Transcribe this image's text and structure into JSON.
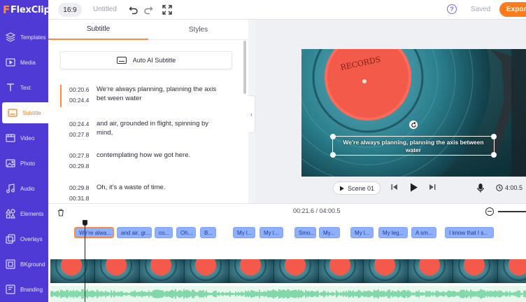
{
  "app": {
    "logo": "FlexClip",
    "title": "Untitled"
  },
  "toolbar": {
    "ratio": "16:9",
    "saved_label": "Saved",
    "export_label": "Export",
    "help": "?"
  },
  "sidebar": {
    "items": [
      {
        "label": "Templates",
        "icon": "layers-icon"
      },
      {
        "label": "Media",
        "icon": "media-icon"
      },
      {
        "label": "Text",
        "icon": "text-icon"
      },
      {
        "label": "Subtitle",
        "icon": "subtitle-icon",
        "active": true
      },
      {
        "label": "Video",
        "icon": "video-icon"
      },
      {
        "label": "Photo",
        "icon": "photo-icon"
      },
      {
        "label": "Audio",
        "icon": "audio-icon"
      },
      {
        "label": "Elements",
        "icon": "elements-icon"
      },
      {
        "label": "Overlays",
        "icon": "overlays-icon"
      },
      {
        "label": "BKground",
        "icon": "background-icon"
      },
      {
        "label": "Branding",
        "icon": "branding-icon"
      }
    ]
  },
  "panel": {
    "tabs": [
      "Subtitle",
      "Styles"
    ],
    "auto_ai_label": "Auto AI Subtitle",
    "subtitles": [
      {
        "start": "00:20.6",
        "end": "00:24.4",
        "text": "We're always planning, planning the axis bet ween water"
      },
      {
        "start": "00:24.4",
        "end": "00:27.8",
        "text": "and air, grounded in flight, spinning by mind,"
      },
      {
        "start": "00:27.8",
        "end": "00:29.8",
        "text": "contemplating how we got here."
      },
      {
        "start": "00:29.8",
        "end": "00:31.8",
        "text": "Oh, it's a waste of time."
      }
    ]
  },
  "preview": {
    "caption": "We're always planning, planning the axis between water",
    "scene_label": "Scene 01",
    "duration": "4:00.5",
    "record_label": "RECORDS"
  },
  "timeline": {
    "timecode": "00:21.6 / 04:00.5",
    "clips": [
      "We're alwa...",
      "and air, gr...",
      "co...",
      "Oh...",
      "B...",
      "My l...",
      "My l...",
      "Smo...",
      "My...",
      "My l...",
      "My leg...",
      "A sm...",
      "I know that I s..."
    ]
  },
  "colors": {
    "brand": "#4f3ad6",
    "accent": "#ff7a1a",
    "clip": "#8fb0ff"
  }
}
